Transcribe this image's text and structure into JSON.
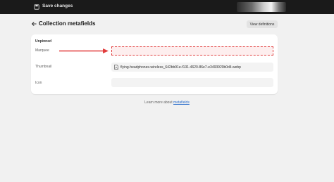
{
  "topbar": {
    "save_label": "Save changes",
    "save_icon": "save-icon"
  },
  "header": {
    "back_icon": "arrow-left-icon",
    "title": "Collection metafields",
    "view_definitions_label": "View definitions"
  },
  "card": {
    "section_title": "Unpinned",
    "fields": [
      {
        "label": "Marquee",
        "value": ""
      },
      {
        "label": "Thumbnail",
        "value": "flying-headphones-wireless_642bb91e-f131-4620-86e7-e3493920b0d4.webp",
        "icon": "file-icon"
      },
      {
        "label": "Icon",
        "value": ""
      }
    ]
  },
  "annotation": {
    "arrow_color": "#e13c3c"
  },
  "footer": {
    "text": "Learn more about",
    "link": "metafields"
  }
}
